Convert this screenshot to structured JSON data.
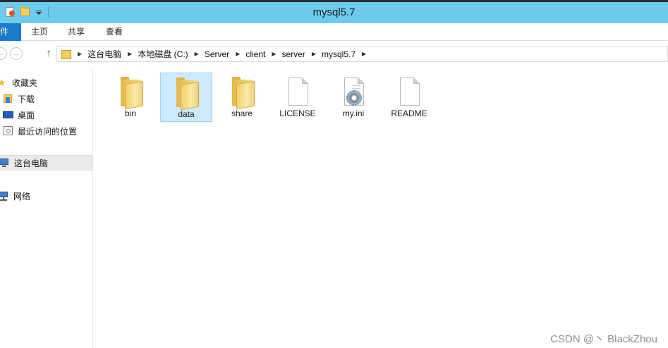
{
  "window": {
    "title": "mysql5.7"
  },
  "ribbon": {
    "tabs": [
      {
        "label": "文件"
      },
      {
        "label": "主页"
      },
      {
        "label": "共享"
      },
      {
        "label": "查看"
      }
    ]
  },
  "address": {
    "crumbs": [
      "这台电脑",
      "本地磁盘 (C:)",
      "Server",
      "client",
      "server",
      "mysql5.7"
    ]
  },
  "sidebar": {
    "items": [
      {
        "label": "收藏夹",
        "icon": "star-icon"
      },
      {
        "label": "下载",
        "icon": "download-folder-icon"
      },
      {
        "label": "桌面",
        "icon": "desktop-icon"
      },
      {
        "label": "最近访问的位置",
        "icon": "recent-places-icon"
      },
      {
        "label": "这台电脑",
        "icon": "computer-icon"
      },
      {
        "label": "网络",
        "icon": "network-icon"
      }
    ]
  },
  "files": [
    {
      "name": "bin",
      "type": "folder"
    },
    {
      "name": "data",
      "type": "folder"
    },
    {
      "name": "share",
      "type": "folder"
    },
    {
      "name": "LICENSE",
      "type": "document"
    },
    {
      "name": "my.ini",
      "type": "config"
    },
    {
      "name": "README",
      "type": "document"
    }
  ],
  "watermark": "CSDN @丶 BlackZhou",
  "colors": {
    "titlebar": "#6dcbec",
    "file_tab": "#1979ca",
    "selection": "#cde8ff"
  }
}
